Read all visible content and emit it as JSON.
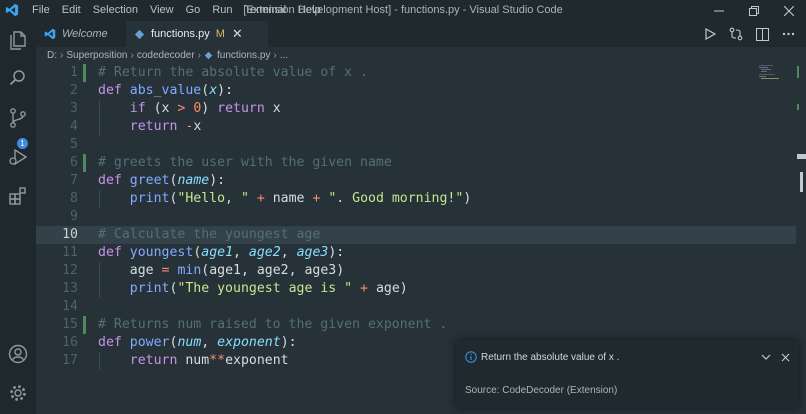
{
  "window": {
    "title": "[Extension Development Host] - functions.py - Visual Studio Code",
    "menu": [
      "File",
      "Edit",
      "Selection",
      "View",
      "Go",
      "Run",
      "Terminal",
      "Help"
    ]
  },
  "activity": {
    "scm_badge": "1",
    "icons": [
      "explorer-icon",
      "search-icon",
      "source-control-icon",
      "run-debug-icon",
      "extensions-icon",
      "account-icon",
      "settings-gear-icon"
    ]
  },
  "tabs": [
    {
      "label": "Welcome",
      "italic": true
    },
    {
      "label": "functions.py",
      "modified": "M",
      "active": true
    }
  ],
  "breadcrumbs": [
    "D:",
    "Superposition",
    "codedecoder",
    "functions.py",
    "..."
  ],
  "editor": {
    "current_line": 10,
    "line_numbers": [
      "1",
      "2",
      "3",
      "4",
      "5",
      "6",
      "7",
      "8",
      "9",
      "10",
      "11",
      "12",
      "13",
      "14",
      "15",
      "16",
      "17"
    ]
  },
  "notification": {
    "message": "Return the absolute value of x .",
    "source": "Source: CodeDecoder (Extension)"
  },
  "colors": {
    "background": "#263238",
    "keyword": "#c792ea",
    "function": "#82aaff",
    "comment": "#546e7a",
    "string": "#c3e88d",
    "operator": "#f78c6c"
  }
}
